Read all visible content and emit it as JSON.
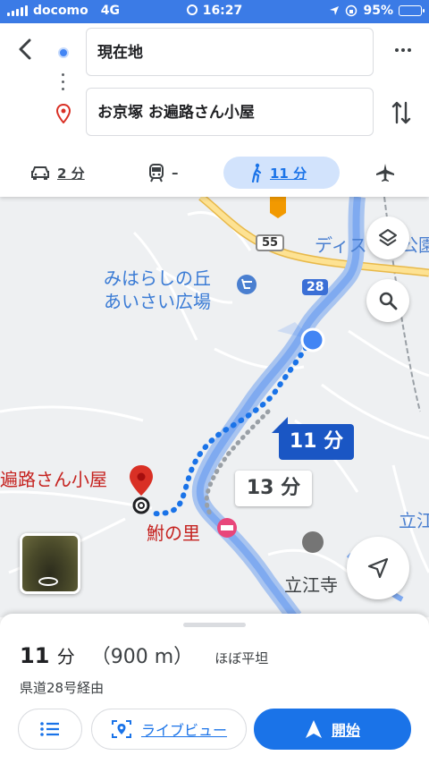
{
  "status_bar": {
    "carrier": "docomo",
    "network": "4G",
    "time": "16:27",
    "battery": "95%",
    "battery_level": 0.95
  },
  "directions": {
    "origin": "現在地",
    "destination": "お京塚 お遍路さん小屋",
    "modes": [
      {
        "icon": "car-icon",
        "label": "2 分"
      },
      {
        "icon": "train-icon",
        "label": "–"
      },
      {
        "icon": "walk-icon",
        "label": "11 分",
        "selected": true
      },
      {
        "icon": "airplane-icon",
        "label": ""
      }
    ]
  },
  "map": {
    "labels": {
      "park_line1": "みはらしの丘",
      "park_line2": "あいさい広場",
      "destination": "遍路さん小屋",
      "restaurant": "鮒の里",
      "temple": "立江寺",
      "top_right": "ディス",
      "top_right_2": "公園",
      "right_edge": "立江"
    },
    "road_55": "55",
    "road_28": "28",
    "eta_selected": "11 分",
    "eta_alternate": "13 分"
  },
  "route_summary": {
    "time_value": "11",
    "time_unit": "分",
    "distance": "（900 m）",
    "elevation": "ほぼ平坦",
    "via": "県道28号経由"
  },
  "actions": {
    "live_view": "ライブビュー",
    "start": "開始"
  },
  "colors": {
    "accent": "#1a73e8",
    "route": "#4285f4",
    "status_bar": "#3b7be6",
    "destination_pin": "#d93025"
  }
}
